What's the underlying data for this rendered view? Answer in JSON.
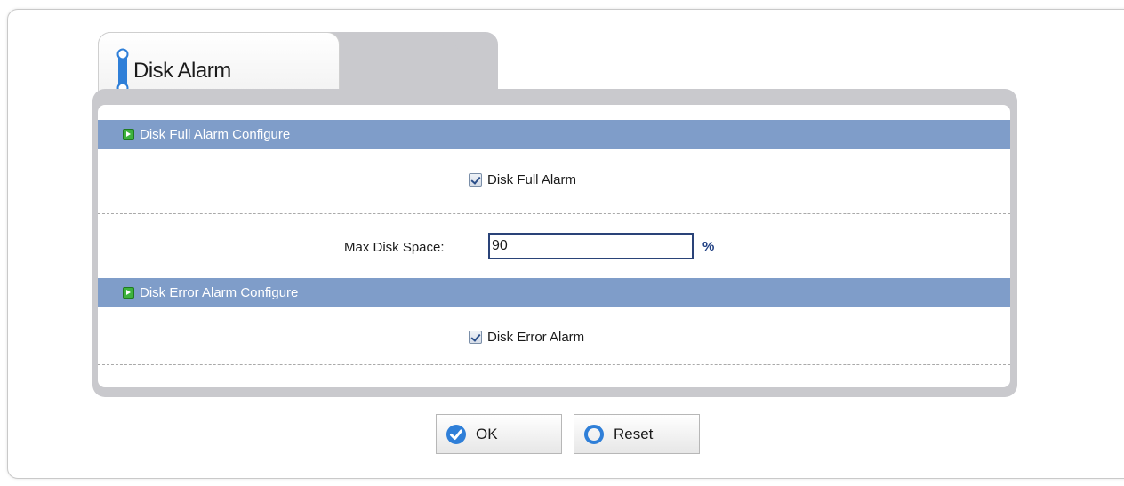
{
  "tab": {
    "title": "Disk Alarm"
  },
  "sections": {
    "disk_full": {
      "header": "Disk Full Alarm Configure",
      "checkbox_label": "Disk Full Alarm",
      "checked": true,
      "max_space_label": "Max Disk Space:",
      "max_space_value": "90",
      "unit": "%"
    },
    "disk_error": {
      "header": "Disk Error Alarm Configure",
      "checkbox_label": "Disk Error Alarm",
      "checked": true
    }
  },
  "buttons": {
    "ok": "OK",
    "reset": "Reset"
  },
  "colors": {
    "section_bar": "#7f9dc9",
    "panel_gray": "#c9c9cd",
    "icon_blue": "#2f7fd8"
  }
}
